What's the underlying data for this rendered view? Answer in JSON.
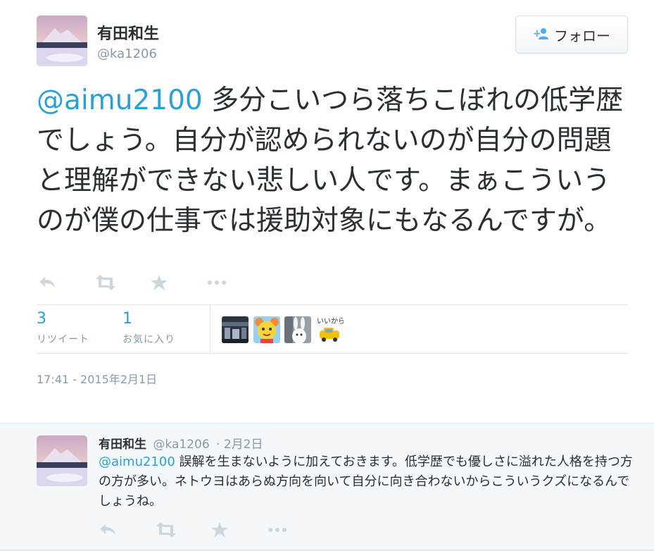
{
  "tweet": {
    "author_name": "有田和生",
    "author_handle": "@ka1206",
    "follow_label": "フォロー",
    "mention": "@aimu2100",
    "text": " 多分こいつら落ちこぼれの低学歴でしょう。自分が認められないのが自分の問題と理解ができない悲しい人です。まぁこういうのが僕の仕事では援助対象にもなるんですが。",
    "retweets_count": "3",
    "retweets_label": "リツイート",
    "favorites_count": "1",
    "favorites_label": "お気に入り",
    "timestamp": "17:41 - 2015年2月1日"
  },
  "reply": {
    "author_name": "有田和生",
    "author_handle": "@ka1206",
    "date": "· 2月2日",
    "mention": "@aimu2100",
    "text": " 誤解を生まないように加えておきます。低学歴でも優しさに溢れた人格を持つ方の方が多い。ネトウヨはあらぬ方向を向いて自分に向き合わないからこういうクズになるんでしょうね。"
  },
  "fav_avatars": [
    {
      "icon": "station-photo-avatar"
    },
    {
      "icon": "yellow-character-avatar"
    },
    {
      "icon": "white-rabbit-avatar"
    },
    {
      "icon": "iikara-car-avatar",
      "caption": "いいから"
    }
  ],
  "icons": [
    "reply-icon",
    "retweet-icon",
    "favorite-star-icon",
    "more-icon",
    "follow-person-icon"
  ],
  "colors": {
    "link": "#2aa0d4",
    "text": "#292f33",
    "muted": "#8899a6",
    "icon": "#ccd6dd",
    "reply_bg": "#f5f8fa"
  }
}
